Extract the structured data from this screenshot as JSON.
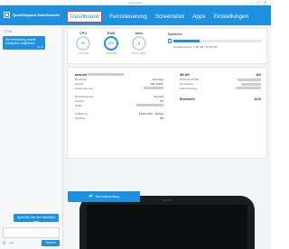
{
  "window": {
    "title": "TeamViewer",
    "controls": [
      "—",
      "☐",
      "✕"
    ]
  },
  "app": {
    "name": "QuickSupport-Dateitransfer"
  },
  "tabs": [
    "Dashboard",
    "Fernsteuerung",
    "Screenshot",
    "Apps",
    "Einstellungen"
  ],
  "active_tab": "Dashboard",
  "sidebar": {
    "chat_title": "Chat",
    "bubble_message": "Die Verbindung wurde erfolgreich aufgebaut.",
    "bubble_time": "13:44",
    "quick_message": "Sprechen Sie Ihre Nachricht hier",
    "send_label": "Senden",
    "tool_icons": [
      "paperclip-icon",
      "screenshot-icon"
    ]
  },
  "stats": {
    "cpu": {
      "label": "CPU",
      "value": "0%",
      "sub": "1.72 GHz",
      "percent": 0
    },
    "ram": {
      "label": "RAM",
      "value": "40%",
      "sub": "1742 MB",
      "percent": 40
    },
    "akku": {
      "label": "Akku",
      "value": "",
      "sub": "84% | 38°C",
      "percent": 84
    },
    "storage": {
      "label": "Speicher",
      "text": "Gerätespeicher: 7.58 GB / 25.45 GB",
      "percent": 30
    }
  },
  "device": {
    "title": "android",
    "rows": [
      {
        "label": "Hersteller",
        "value": "samsung"
      },
      {
        "label": "Modell",
        "value": "SM-J330F"
      },
      {
        "label": "Seriennummer",
        "value": ""
      }
    ],
    "rows2": [
      {
        "label": "Betriebssystem",
        "value": "Android"
      },
      {
        "label": "Version",
        "value": "8.0"
      },
      {
        "label": "UDID",
        "value": ""
      }
    ],
    "rows3": [
      {
        "label": "Auflösung",
        "value": "1080x1920 - 480dpi"
      },
      {
        "label": "Sprache",
        "value": "DE"
      }
    ]
  },
  "network": {
    "wlan_title": "WLAN",
    "wlan_status": "AN",
    "rows": [
      {
        "label": "Netzwerk-SSID",
        "value": ""
      },
      {
        "label": "IP-Adresse",
        "value": ""
      },
      {
        "label": "MAC-Adresse",
        "value": ""
      }
    ],
    "bt_title": "Bluetooth",
    "bt_status": "AUS"
  },
  "remote_control_label": "Fernsteuerung"
}
